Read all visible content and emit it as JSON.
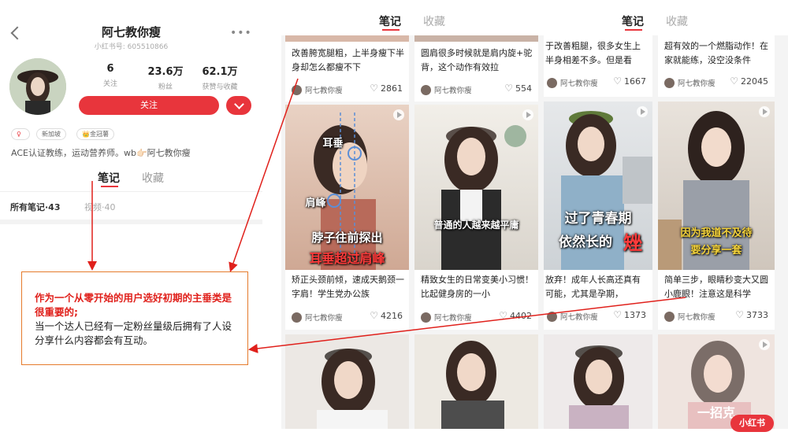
{
  "profile": {
    "name": "阿七教你瘦",
    "id": "小红书号: 605510866",
    "stats": [
      {
        "value": "6",
        "label": "关注"
      },
      {
        "value": "23.6万",
        "label": "粉丝"
      },
      {
        "value": "62.1万",
        "label": "获赞与收藏"
      }
    ],
    "follow_label": "关注",
    "tags": [
      "新加坡",
      "金冠薯"
    ],
    "bio": "ACE认证教练，运动营养师。wb👉🏻阿七教你瘦",
    "tabs": {
      "active": "笔记",
      "inactive": "收藏"
    },
    "all_notes": "所有笔记·43",
    "videos": "视频·40"
  },
  "feed_tabs": [
    {
      "active": "笔记",
      "inactive": "收藏"
    },
    {
      "active": "笔记",
      "inactive": "收藏"
    }
  ],
  "cards": [
    {
      "caption": "改善胯宽腿粗，上半身瘦下半身却怎么都瘦不下",
      "author": "阿七教你瘦",
      "likes": "2861"
    },
    {
      "caption": "圆肩很多时候就是肩内旋+驼背，这个动作有效拉",
      "author": "阿七教你瘦",
      "likes": "554"
    },
    {
      "caption": "于改善粗腿，很多女生上半身相差不多。但是看",
      "author": "阿七教你瘦",
      "likes": "1667"
    },
    {
      "caption": "超有效的一个燃脂动作！在家就能练，没空没条件",
      "author": "阿七教你瘦",
      "likes": "22045"
    },
    {
      "caption": "矫正头颈前倾，速成天鹅颈一字肩！学生党办公族",
      "author": "阿七教你瘦",
      "likes": "4216",
      "overlay": [
        "耳垂",
        "肩峰",
        "脖子往前探出",
        "耳垂超过肩峰"
      ]
    },
    {
      "caption": "精致女生的日常变美小习惯！比起健身房的一小",
      "author": "阿七教你瘦",
      "likes": "4402",
      "overlay": [
        "普通的人越来越平庸"
      ]
    },
    {
      "caption": "放弃！成年人长高还真有可能，尤其是孕期，",
      "author": "阿七教你瘦",
      "likes": "1373",
      "overlay": [
        "过了青春期",
        "依然长的",
        "矬"
      ]
    },
    {
      "caption": "简单三步，眼睛秒变大又圆小鹿眼！注意这是科学",
      "author": "阿七教你瘦",
      "likes": "3733",
      "overlay": [
        "因为我道不及待",
        "要分享一套"
      ]
    },
    {
      "overlay": [
        "一招克"
      ]
    }
  ],
  "annotation": {
    "emphasis": "作为一个从零开始的用户选好初期的主垂类是很重要的;",
    "body": "当一个达人已经有一定粉丝量级后拥有了人设分享什么内容都会有互动。"
  },
  "watermark": "小红书",
  "colors": {
    "brand_red": "#e8353c",
    "annotation_red": "#e0201b",
    "box_border": "#e57b2c"
  }
}
